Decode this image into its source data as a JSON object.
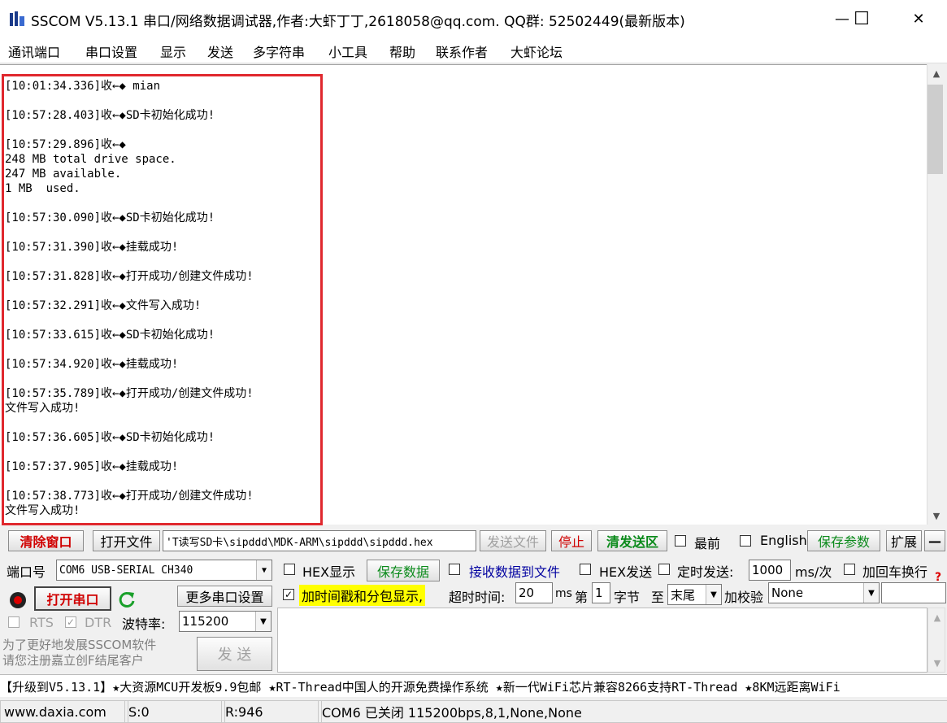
{
  "window": {
    "title": "SSCOM V5.13.1 串口/网络数据调试器,作者:大虾丁丁,2618058@qq.com. QQ群: 52502449(最新版本)",
    "minimize_glyph": "—",
    "maximize_glyph": "☐",
    "close_glyph": "✕"
  },
  "menu": [
    "通讯端口",
    "串口设置",
    "显示",
    "发送",
    "多字符串",
    "小工具",
    "帮助",
    "联系作者",
    "大虾论坛"
  ],
  "log": [
    "[10:01:34.336]收←◆ mian",
    "",
    "[10:57:28.403]收←◆SD卡初始化成功!",
    "",
    "[10:57:29.896]收←◆",
    "248 MB total drive space.",
    "247 MB available.",
    "1 MB  used.",
    "",
    "[10:57:30.090]收←◆SD卡初始化成功!",
    "",
    "[10:57:31.390]收←◆挂载成功!",
    "",
    "[10:57:31.828]收←◆打开成功/创建文件成功!",
    "",
    "[10:57:32.291]收←◆文件写入成功!",
    "",
    "[10:57:33.615]收←◆SD卡初始化成功!",
    "",
    "[10:57:34.920]收←◆挂载成功!",
    "",
    "[10:57:35.789]收←◆打开成功/创建文件成功!",
    "文件写入成功!",
    "",
    "[10:57:36.605]收←◆SD卡初始化成功!",
    "",
    "[10:57:37.905]收←◆挂载成功!",
    "",
    "[10:57:38.773]收←◆打开成功/创建文件成功!",
    "文件写入成功!"
  ],
  "toolbar1": {
    "clear_window": "清除窗口",
    "open_file": "打开文件",
    "file_path": "'T读写SD卡\\sipddd\\MDK-ARM\\sipddd\\sipddd.hex",
    "send_file": "发送文件",
    "stop": "停止",
    "clear_send": "清发送区",
    "topmost": "最前",
    "english": "English",
    "save_params": "保存参数",
    "expand": "扩展",
    "collapse": "—"
  },
  "port": {
    "port_label": "端口号",
    "port_value": "COM6 USB-SERIAL CH340",
    "open_port": "打开串口",
    "more_settings": "更多串口设置",
    "rts": "RTS",
    "dtr": "DTR",
    "baud_label": "波特率:",
    "baud_value": "115200"
  },
  "options": {
    "hex_display": "HEX显示",
    "save_data": "保存数据",
    "recv_to_file": "接收数据到文件",
    "hex_send": "HEX发送",
    "timed_send": "定时发送:",
    "interval": "1000",
    "interval_unit": "ms/次",
    "add_crlf": "加回车换行",
    "timestamp": "加时间戳和分包显示,",
    "timeout_label": "超时时间:",
    "timeout_value": "20",
    "timeout_unit": "ms",
    "byte_prefix": "第",
    "byte_value": "1",
    "byte_label": "字节",
    "to_label": "至",
    "to_value": "末尾",
    "checksum_label": "加校验",
    "checksum_value": "None"
  },
  "send": {
    "promo_line1": "为了更好地发展SSCOM软件",
    "promo_line2": "请您注册嘉立创F结尾客户",
    "send_button": "发  送"
  },
  "ticker": "【升级到V5.13.1】★大资源MCU开发板9.9包邮 ★RT-Thread中国人的开源免费操作系统 ★新一代WiFi芯片兼容8266支持RT-Thread ★8KM远距离WiFi",
  "status": {
    "site": "www.daxia.com",
    "sent": "S:0",
    "received": "R:946",
    "port_state": "COM6 已关闭  115200bps,8,1,None,None"
  },
  "colors": {
    "highlight_border": "#e0282e",
    "timestamp_bg": "#ffff00"
  }
}
